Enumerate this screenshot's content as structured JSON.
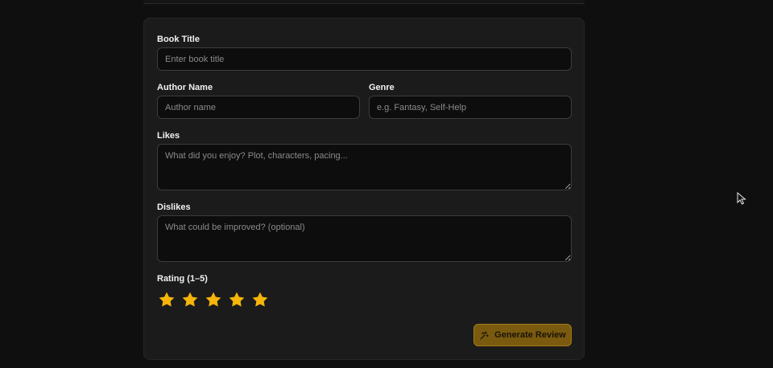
{
  "form": {
    "book_title": {
      "label": "Book Title",
      "placeholder": "Enter book title",
      "value": ""
    },
    "author_name": {
      "label": "Author Name",
      "placeholder": "Author name",
      "value": ""
    },
    "genre": {
      "label": "Genre",
      "placeholder": "e.g. Fantasy, Self-Help",
      "value": ""
    },
    "likes": {
      "label": "Likes",
      "placeholder": "What did you enjoy? Plot, characters, pacing...",
      "value": ""
    },
    "dislikes": {
      "label": "Dislikes",
      "placeholder": "What could be improved? (optional)",
      "value": ""
    },
    "rating": {
      "label": "Rating (1–5)",
      "value": 5,
      "max": 5
    }
  },
  "actions": {
    "generate_label": "Generate Review",
    "generate_icon": "sparkles-icon"
  },
  "colors": {
    "accent": "#f5b50a",
    "button_bg": "#7a5a0f",
    "card_bg": "#1b1b1b",
    "page_bg": "#0f0f0f"
  }
}
